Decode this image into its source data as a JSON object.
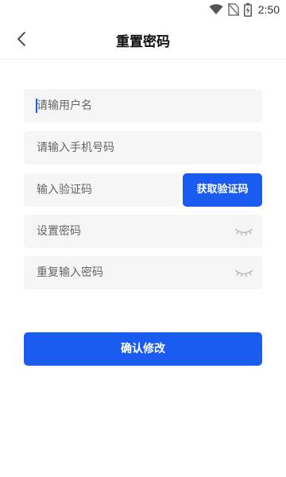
{
  "status_bar": {
    "time": "2:50",
    "icons": [
      "wifi-icon",
      "no-sim-icon",
      "battery-icon"
    ]
  },
  "header": {
    "title": "重置密码",
    "back_icon": "chevron-left-icon"
  },
  "form": {
    "username": {
      "placeholder": "请输用户名",
      "value": ""
    },
    "phone": {
      "placeholder": "请输入手机号码",
      "value": ""
    },
    "code": {
      "placeholder": "输入验证码",
      "value": ""
    },
    "get_code_label": "获取验证码",
    "password": {
      "placeholder": "设置密码",
      "value": "",
      "icon": "eye-closed-icon"
    },
    "password_repeat": {
      "placeholder": "重复输入密码",
      "value": "",
      "icon": "eye-closed-icon"
    },
    "submit_label": "确认修改"
  },
  "colors": {
    "accent": "#1a5bf0",
    "field_background": "#f5f5f5",
    "placeholder": "#666666"
  }
}
